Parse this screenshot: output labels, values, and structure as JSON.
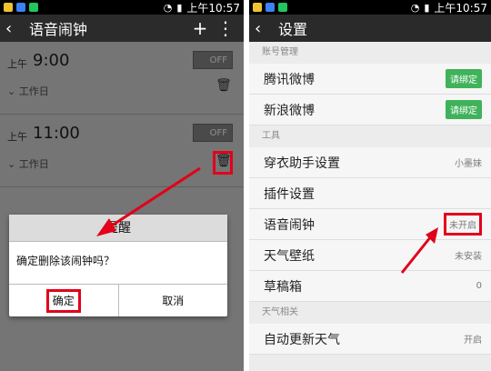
{
  "status_left": {
    "time": "上午10:57"
  },
  "status_right": {
    "time": "上午10:57"
  },
  "left_screen": {
    "title": "语音闹钟",
    "add_icon": "+",
    "more_icon": "⋮",
    "alarms": [
      {
        "ampm": "上午",
        "time": "9:00",
        "toggle": "OFF",
        "repeat": "工作日"
      },
      {
        "ampm": "上午",
        "time": "11:00",
        "toggle": "OFF",
        "repeat": "工作日"
      }
    ],
    "dialog": {
      "title": "提醒",
      "message": "确定删除该闹钟吗？",
      "confirm": "确定",
      "cancel": "取消"
    }
  },
  "right_screen": {
    "title": "设置",
    "sections": [
      {
        "header": "账号管理",
        "rows": [
          {
            "label": "腾讯微博",
            "badge": "请绑定"
          },
          {
            "label": "新浪微博",
            "badge": "请绑定"
          }
        ]
      },
      {
        "header": "工具",
        "rows": [
          {
            "label": "穿衣助手设置",
            "value": "小墨妹"
          },
          {
            "label": "插件设置",
            "value": ""
          },
          {
            "label": "语音闹钟",
            "value": "未开启"
          },
          {
            "label": "天气壁纸",
            "value": "未安装"
          },
          {
            "label": "草稿箱",
            "value": "0"
          }
        ]
      },
      {
        "header": "天气相关",
        "rows": [
          {
            "label": "自动更新天气",
            "value": "开启"
          }
        ]
      }
    ]
  },
  "colors": {
    "highlight": "#e2001a",
    "badge": "#3fb25a"
  },
  "icons": [
    "back-arrow-icon",
    "add-icon",
    "more-icon",
    "trash-icon",
    "chevron-down-icon",
    "wifi-icon",
    "battery-icon",
    "signal-icon"
  ]
}
